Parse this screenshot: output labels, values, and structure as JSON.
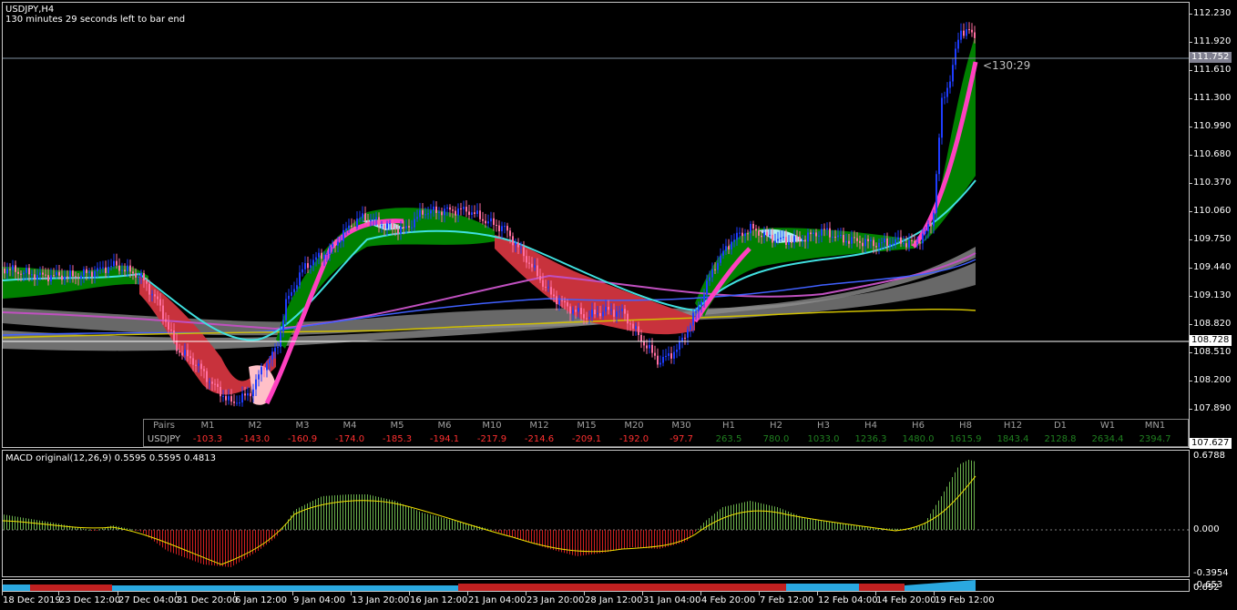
{
  "header": {
    "symbol_timeframe": "USDJPY,H4",
    "bar_timer": "130 minutes 29 seconds left to bar end"
  },
  "price_scale": {
    "labels": [
      "112.230",
      "111.920",
      "111.610",
      "111.300",
      "110.990",
      "110.680",
      "110.370",
      "110.060",
      "109.750",
      "109.440",
      "109.130",
      "108.820",
      "108.510",
      "108.200",
      "107.890"
    ],
    "current_price": "111.752",
    "horizontal_line_price": "108.728",
    "bottom_price": "107.627",
    "countdown": "<130:29"
  },
  "heat_table": {
    "header": [
      "Pairs",
      "M1",
      "M2",
      "M3",
      "M4",
      "M5",
      "M6",
      "M10",
      "M12",
      "M15",
      "M20",
      "M30",
      "H1",
      "H2",
      "H3",
      "H4",
      "H6",
      "H8",
      "H12",
      "D1",
      "W1",
      "MN1"
    ],
    "row_label": "USDJPY",
    "values": [
      "-103.3",
      "-143.0",
      "-160.9",
      "-174.0",
      "-185.3",
      "-194.1",
      "-217.9",
      "-214.6",
      "-209.1",
      "-192.0",
      "-97.7",
      "263.5",
      "780.0",
      "1033.0",
      "1236.3",
      "1480.0",
      "1615.9",
      "1843.4",
      "2128.8",
      "2634.4",
      "2394.7"
    ]
  },
  "macd": {
    "title": "MACD original(12,26,9) 0.5595 0.5595 0.4813",
    "scale_labels": [
      "0.6788",
      "0.000",
      "-0.3954",
      "-0.653"
    ],
    "bottom_pane_label": "0.692"
  },
  "time_axis": {
    "labels": [
      "18 Dec 2019",
      "23 Dec 12:00",
      "27 Dec 04:00",
      "31 Dec 20:00",
      "6 Jan 12:00",
      "9 Jan 04:00",
      "13 Jan 20:00",
      "16 Jan 12:00",
      "21 Jan 04:00",
      "23 Jan 20:00",
      "28 Jan 12:00",
      "31 Jan 04:00",
      "4 Feb 20:00",
      "7 Feb 12:00",
      "12 Feb 04:00",
      "14 Feb 20:00",
      "19 Feb 12:00"
    ]
  },
  "colors": {
    "bull_cloud": "#008000",
    "bear_cloud": "#c8323c",
    "bull_candle": "#1e3cff",
    "bear_candle": "#ff6ea0",
    "cyan_ma": "#40e0e0",
    "magenta_ma": "#ff40c0",
    "macd_pos": "#6ab04c",
    "macd_neg": "#d02020",
    "signal": "#f0e000",
    "table_neg": "#ff3030",
    "table_pos": "#208020"
  }
}
